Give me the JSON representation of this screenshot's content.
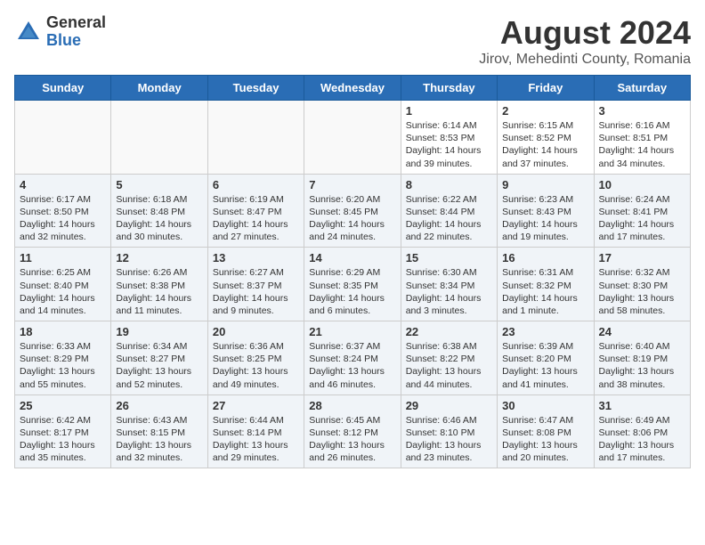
{
  "header": {
    "logo_general": "General",
    "logo_blue": "Blue",
    "title": "August 2024",
    "subtitle": "Jirov, Mehedinti County, Romania"
  },
  "weekdays": [
    "Sunday",
    "Monday",
    "Tuesday",
    "Wednesday",
    "Thursday",
    "Friday",
    "Saturday"
  ],
  "weeks": [
    [
      {
        "day": "",
        "info": ""
      },
      {
        "day": "",
        "info": ""
      },
      {
        "day": "",
        "info": ""
      },
      {
        "day": "",
        "info": ""
      },
      {
        "day": "1",
        "info": "Sunrise: 6:14 AM\nSunset: 8:53 PM\nDaylight: 14 hours\nand 39 minutes."
      },
      {
        "day": "2",
        "info": "Sunrise: 6:15 AM\nSunset: 8:52 PM\nDaylight: 14 hours\nand 37 minutes."
      },
      {
        "day": "3",
        "info": "Sunrise: 6:16 AM\nSunset: 8:51 PM\nDaylight: 14 hours\nand 34 minutes."
      }
    ],
    [
      {
        "day": "4",
        "info": "Sunrise: 6:17 AM\nSunset: 8:50 PM\nDaylight: 14 hours\nand 32 minutes."
      },
      {
        "day": "5",
        "info": "Sunrise: 6:18 AM\nSunset: 8:48 PM\nDaylight: 14 hours\nand 30 minutes."
      },
      {
        "day": "6",
        "info": "Sunrise: 6:19 AM\nSunset: 8:47 PM\nDaylight: 14 hours\nand 27 minutes."
      },
      {
        "day": "7",
        "info": "Sunrise: 6:20 AM\nSunset: 8:45 PM\nDaylight: 14 hours\nand 24 minutes."
      },
      {
        "day": "8",
        "info": "Sunrise: 6:22 AM\nSunset: 8:44 PM\nDaylight: 14 hours\nand 22 minutes."
      },
      {
        "day": "9",
        "info": "Sunrise: 6:23 AM\nSunset: 8:43 PM\nDaylight: 14 hours\nand 19 minutes."
      },
      {
        "day": "10",
        "info": "Sunrise: 6:24 AM\nSunset: 8:41 PM\nDaylight: 14 hours\nand 17 minutes."
      }
    ],
    [
      {
        "day": "11",
        "info": "Sunrise: 6:25 AM\nSunset: 8:40 PM\nDaylight: 14 hours\nand 14 minutes."
      },
      {
        "day": "12",
        "info": "Sunrise: 6:26 AM\nSunset: 8:38 PM\nDaylight: 14 hours\nand 11 minutes."
      },
      {
        "day": "13",
        "info": "Sunrise: 6:27 AM\nSunset: 8:37 PM\nDaylight: 14 hours\nand 9 minutes."
      },
      {
        "day": "14",
        "info": "Sunrise: 6:29 AM\nSunset: 8:35 PM\nDaylight: 14 hours\nand 6 minutes."
      },
      {
        "day": "15",
        "info": "Sunrise: 6:30 AM\nSunset: 8:34 PM\nDaylight: 14 hours\nand 3 minutes."
      },
      {
        "day": "16",
        "info": "Sunrise: 6:31 AM\nSunset: 8:32 PM\nDaylight: 14 hours\nand 1 minute."
      },
      {
        "day": "17",
        "info": "Sunrise: 6:32 AM\nSunset: 8:30 PM\nDaylight: 13 hours\nand 58 minutes."
      }
    ],
    [
      {
        "day": "18",
        "info": "Sunrise: 6:33 AM\nSunset: 8:29 PM\nDaylight: 13 hours\nand 55 minutes."
      },
      {
        "day": "19",
        "info": "Sunrise: 6:34 AM\nSunset: 8:27 PM\nDaylight: 13 hours\nand 52 minutes."
      },
      {
        "day": "20",
        "info": "Sunrise: 6:36 AM\nSunset: 8:25 PM\nDaylight: 13 hours\nand 49 minutes."
      },
      {
        "day": "21",
        "info": "Sunrise: 6:37 AM\nSunset: 8:24 PM\nDaylight: 13 hours\nand 46 minutes."
      },
      {
        "day": "22",
        "info": "Sunrise: 6:38 AM\nSunset: 8:22 PM\nDaylight: 13 hours\nand 44 minutes."
      },
      {
        "day": "23",
        "info": "Sunrise: 6:39 AM\nSunset: 8:20 PM\nDaylight: 13 hours\nand 41 minutes."
      },
      {
        "day": "24",
        "info": "Sunrise: 6:40 AM\nSunset: 8:19 PM\nDaylight: 13 hours\nand 38 minutes."
      }
    ],
    [
      {
        "day": "25",
        "info": "Sunrise: 6:42 AM\nSunset: 8:17 PM\nDaylight: 13 hours\nand 35 minutes."
      },
      {
        "day": "26",
        "info": "Sunrise: 6:43 AM\nSunset: 8:15 PM\nDaylight: 13 hours\nand 32 minutes."
      },
      {
        "day": "27",
        "info": "Sunrise: 6:44 AM\nSunset: 8:14 PM\nDaylight: 13 hours\nand 29 minutes."
      },
      {
        "day": "28",
        "info": "Sunrise: 6:45 AM\nSunset: 8:12 PM\nDaylight: 13 hours\nand 26 minutes."
      },
      {
        "day": "29",
        "info": "Sunrise: 6:46 AM\nSunset: 8:10 PM\nDaylight: 13 hours\nand 23 minutes."
      },
      {
        "day": "30",
        "info": "Sunrise: 6:47 AM\nSunset: 8:08 PM\nDaylight: 13 hours\nand 20 minutes."
      },
      {
        "day": "31",
        "info": "Sunrise: 6:49 AM\nSunset: 8:06 PM\nDaylight: 13 hours\nand 17 minutes."
      }
    ]
  ]
}
